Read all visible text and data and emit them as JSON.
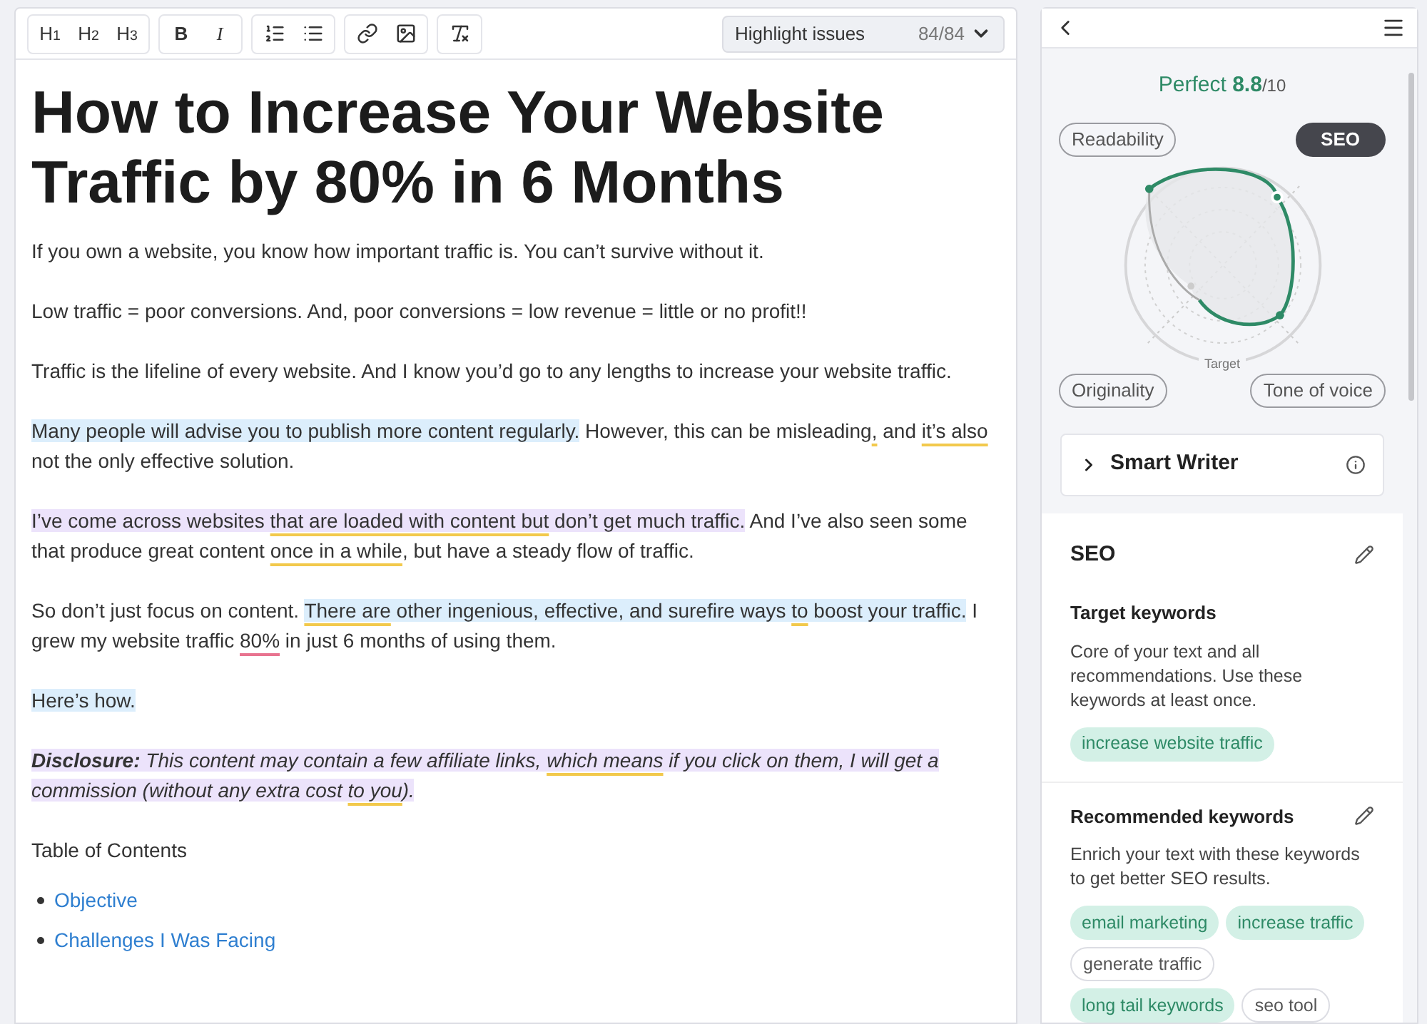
{
  "toolbar": {
    "groups": [
      [
        {
          "kind": "text",
          "label": "H$_{1}$"
        },
        {
          "kind": "text",
          "label": "H$_{2}$"
        },
        {
          "kind": "text",
          "label": "H$_{3}$"
        }
      ],
      [
        {
          "kind": "bold",
          "label": "B"
        },
        {
          "kind": "italic",
          "label": "I"
        }
      ],
      [
        {
          "kind": "ordered-list"
        },
        {
          "kind": "bullet-list"
        }
      ],
      [
        {
          "kind": "link"
        },
        {
          "kind": "image"
        }
      ],
      [
        {
          "kind": "clear-format"
        }
      ]
    ],
    "highlight": {
      "label": "Highlight issues",
      "count": "84/84"
    }
  },
  "article": {
    "title": "How to Increase Your Website Traffic by 80% in 6 Months",
    "paragraphs": [
      {
        "italic": false,
        "segments": [
          {
            "text": "If you own a website, you know how important traffic is. You can’t survive without it."
          }
        ]
      },
      {
        "italic": false,
        "segments": [
          {
            "text": "Low traffic = poor conversions. And, poor conversions = low revenue = little or no profit!!"
          }
        ]
      },
      {
        "italic": false,
        "segments": [
          {
            "text": "Traffic is the lifeline of every website. And I know you’d go to any lengths to increase your website traffic."
          }
        ]
      },
      {
        "italic": false,
        "segments": [
          {
            "text": "Many people will advise you to publish more content regularly.",
            "color": "#dceefc"
          },
          {
            "text": " However, this can be misleading"
          },
          {
            "text": ",",
            "warning": true
          },
          {
            "text": " and "
          },
          {
            "text": "it’s also",
            "warning": true
          },
          {
            "text": " not the only effective solution."
          }
        ]
      },
      {
        "italic": false,
        "segments": [
          {
            "text": "I’ve come across websites ",
            "color": "#ece3fb"
          },
          {
            "text": "that are loaded with content but",
            "color": "#ece3fb",
            "warning": true
          },
          {
            "text": " don’t get much traffic.",
            "color": "#ece3fb"
          },
          {
            "text": " And I’ve also seen some that produce great content "
          },
          {
            "text": "once in a while",
            "warning": true
          },
          {
            "text": ", but have a steady flow of traffic."
          }
        ]
      },
      {
        "italic": false,
        "segments": [
          {
            "text": "So don’t just focus on content. "
          },
          {
            "text": "There are",
            "color": "#dceefc",
            "warning": true
          },
          {
            "text": " other ingenious, effective, and surefire ways ",
            "color": "#dceefc"
          },
          {
            "text": "to",
            "color": "#dceefc",
            "warning": true
          },
          {
            "text": " boost your traffic.",
            "color": "#dceefc"
          },
          {
            "text": " I grew my website traffic "
          },
          {
            "text": "80%",
            "error": true
          },
          {
            "text": " in just 6 months of using them."
          }
        ]
      },
      {
        "italic": false,
        "segments": [
          {
            "text": "Here’s how.",
            "color": "#dceefc"
          }
        ]
      },
      {
        "italic": true,
        "segments": [
          {
            "text": "**Disclosure:** This content may contain a few affiliate links, ",
            "color": "#ece3fb"
          },
          {
            "text": "which means",
            "color": "#ece3fb",
            "warning": true
          },
          {
            "text": " if you click on them, I will get a commission (without any extra cost ",
            "color": "#ece3fb"
          },
          {
            "text": "to you",
            "color": "#ece3fb",
            "warning": true
          },
          {
            "text": ").",
            "color": "#ece3fb"
          }
        ]
      },
      {
        "italic": false,
        "segments": [
          {
            "text": "Table of Contents"
          }
        ]
      }
    ],
    "toc": [
      "Objective",
      "Challenges I Was Facing"
    ]
  },
  "panel": {
    "score": {
      "label": "Perfect",
      "value": "8.8",
      "max": "/10"
    },
    "tabs": [
      {
        "label": "Readability",
        "selected": false
      },
      {
        "label": "SEO",
        "selected": true
      },
      {
        "label": "Originality",
        "selected": false
      },
      {
        "label": "Tone of voice",
        "selected": false
      }
    ],
    "radar_label": "Target",
    "smart_writer": {
      "label": "Smart Writer",
      "expanded": false
    },
    "seo": {
      "title": "SEO",
      "sections": [
        {
          "title": "Target keywords",
          "editable": false,
          "description": "Core of your text and all recommendations. Use these keywords at least once.",
          "keywords": [
            {
              "text": "increase website traffic",
              "used": true
            }
          ]
        },
        {
          "title": "Recommended keywords",
          "editable": true,
          "description": "Enrich your text with these keywords to get better SEO results.",
          "keywords": [
            {
              "text": "email marketing",
              "used": true
            },
            {
              "text": "increase traffic",
              "used": true
            },
            {
              "text": "generate traffic",
              "used": false
            },
            {
              "text": "long tail keywords",
              "used": true
            },
            {
              "text": "seo tool",
              "used": false
            }
          ]
        }
      ]
    }
  }
}
